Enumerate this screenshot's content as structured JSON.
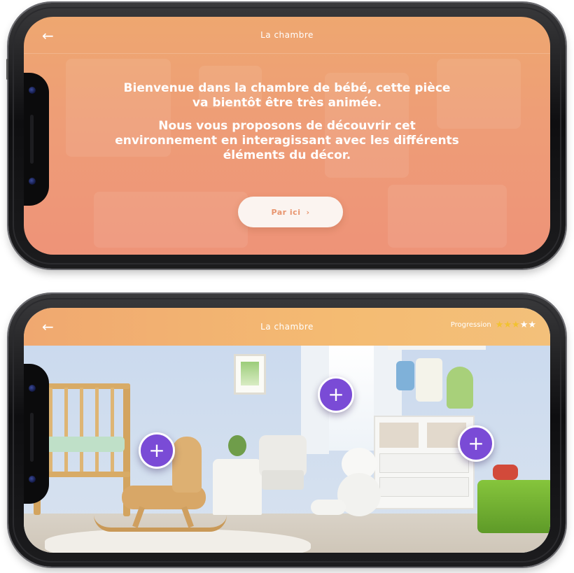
{
  "screen1": {
    "nav": {
      "back_icon": "back-arrow-icon",
      "title": "La chambre"
    },
    "welcome": {
      "paragraph1": "Bienvenue dans la chambre de bébé, cette pièce va bientôt être très animée.",
      "paragraph2": "Nous vous proposons de découvrir cet environnement en interagissant avec les différents éléments du décor."
    },
    "cta": {
      "label": "Par ici",
      "chevron": "›"
    },
    "colors": {
      "gradient_top": "#eea770",
      "gradient_bottom": "#ee9378",
      "cta_text": "#e8956f"
    }
  },
  "screen2": {
    "nav": {
      "back_icon": "back-arrow-icon",
      "title": "La chambre",
      "progress_label": "Progression",
      "stars_total": 5,
      "stars_filled": 3
    },
    "hotspots": [
      "+",
      "+",
      "+"
    ],
    "colors": {
      "hotspot": "#7a4bd6",
      "star_filled": "#f2c230",
      "nav_start": "#f0a870",
      "nav_end": "#f3c07a"
    }
  }
}
